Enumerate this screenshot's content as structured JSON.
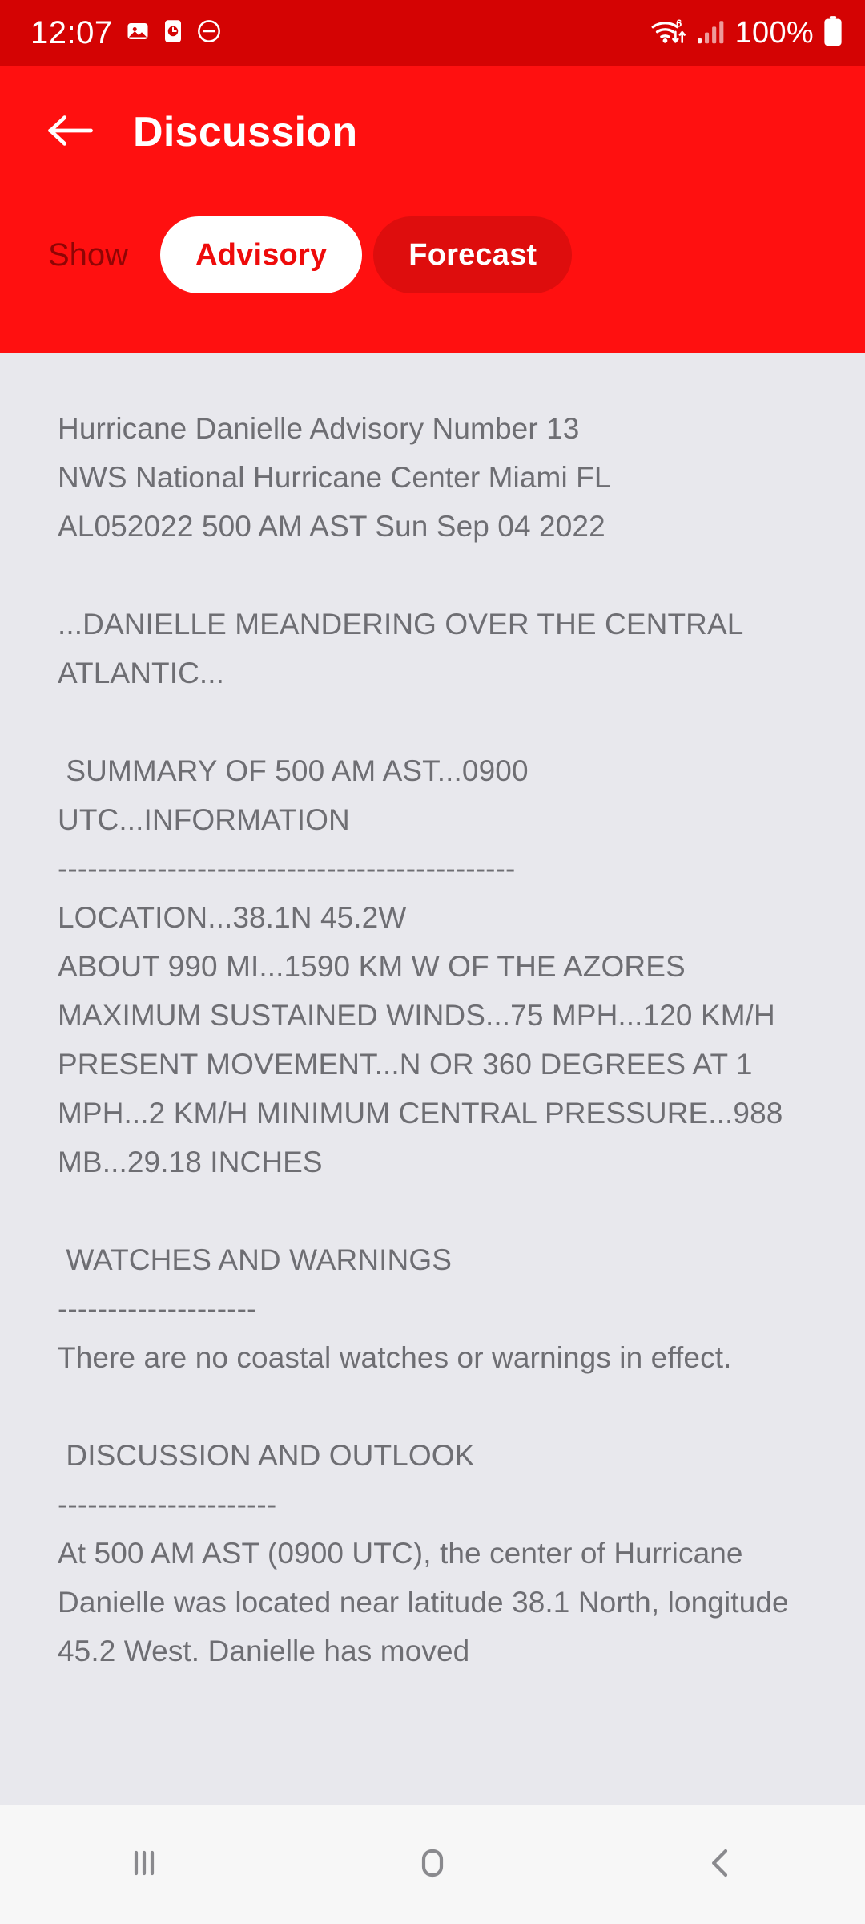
{
  "status_bar": {
    "time": "12:07",
    "battery_label": "100%",
    "icons": [
      "photo-icon",
      "alarm-clock-icon",
      "do-not-disturb-icon",
      "wifi6-icon",
      "cellular-signal-icon",
      "battery-icon"
    ],
    "background_color": "#d40303",
    "foreground_color": "#ffffff"
  },
  "appbar": {
    "title": "Discussion",
    "back_icon": "arrow-left-icon",
    "background_color": "#ff1010",
    "title_color": "#ffffff"
  },
  "toggle": {
    "label": "Show",
    "label_color": "#8f0505",
    "options": [
      {
        "label": "Advisory",
        "selected": true
      },
      {
        "label": "Forecast",
        "selected": false
      }
    ],
    "active_bg": "#ffffff",
    "active_fg": "#ee0b0b",
    "inactive_bg": "#de0d0d",
    "inactive_fg": "#ffffff"
  },
  "content": {
    "text_color": "#6e6e73",
    "background_color": "#e8e8ed",
    "advisory_text": "Hurricane Danielle Advisory Number 13\nNWS National Hurricane Center Miami FL\nAL052022 500 AM AST Sun Sep 04 2022\n\n...DANIELLE MEANDERING OVER THE CENTRAL ATLANTIC...\n\n SUMMARY OF 500 AM AST...0900 UTC...INFORMATION\n----------------------------------------------\nLOCATION...38.1N 45.2W\nABOUT 990 MI...1590 KM W OF THE AZORES\nMAXIMUM SUSTAINED WINDS...75 MPH...120 KM/H\nPRESENT MOVEMENT...N OR 360 DEGREES AT 1 MPH...2 KM/H MINIMUM CENTRAL PRESSURE...988 MB...29.18 INCHES\n\n WATCHES AND WARNINGS\n--------------------\nThere are no coastal watches or warnings in effect.\n\n DISCUSSION AND OUTLOOK\n----------------------\nAt 500 AM AST (0900 UTC), the center of Hurricane Danielle was located near latitude 38.1 North, longitude 45.2 West. Danielle has moved"
  },
  "navbar": {
    "background_color": "#f7f7f7",
    "buttons": [
      {
        "name": "recents-icon"
      },
      {
        "name": "home-icon"
      },
      {
        "name": "back-icon"
      }
    ]
  }
}
